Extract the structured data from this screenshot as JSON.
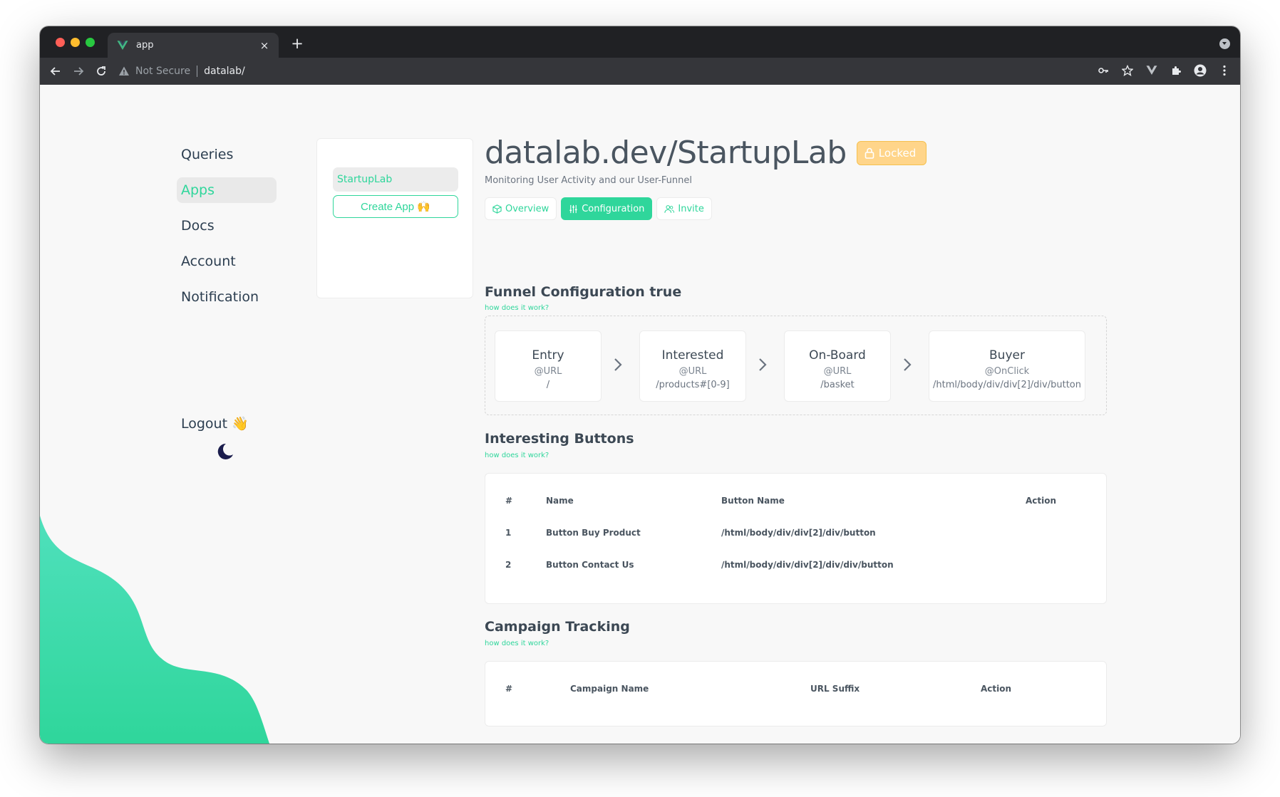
{
  "browser": {
    "tab_title": "app",
    "new_tab_symbol": "+",
    "close_symbol": "×",
    "not_secure": "Not Secure",
    "url": "datalab/"
  },
  "sidebar": {
    "items": [
      {
        "label": "Queries"
      },
      {
        "label": "Apps"
      },
      {
        "label": "Docs"
      },
      {
        "label": "Account"
      },
      {
        "label": "Notification"
      }
    ],
    "logout": "Logout 👋"
  },
  "apps": {
    "items": [
      "StartupLab"
    ],
    "create_label": "Create App 🙌"
  },
  "header": {
    "title": "datalab.dev/StartupLab",
    "locked_label": "Locked",
    "subtitle": "Monitoring User Activity and our User-Funnel"
  },
  "tabs": [
    {
      "label": "Overview",
      "icon": "cube-icon"
    },
    {
      "label": "Configuration",
      "icon": "sliders-icon"
    },
    {
      "label": "Invite",
      "icon": "users-icon"
    }
  ],
  "funnel": {
    "title": "Funnel Configuration true",
    "help": "how does it work?",
    "steps": [
      {
        "name": "Entry",
        "type": "@URL",
        "value": "/"
      },
      {
        "name": "Interested",
        "type": "@URL",
        "value": "/products#[0-9]"
      },
      {
        "name": "On-Board",
        "type": "@URL",
        "value": "/basket"
      },
      {
        "name": "Buyer",
        "type": "@OnClick",
        "value": "/html/body/div/div[2]/div/button"
      }
    ]
  },
  "buttons": {
    "title": "Interesting Buttons",
    "help": "how does it work?",
    "headers": [
      "#",
      "Name",
      "Button Name",
      "Action"
    ],
    "rows": [
      [
        "1",
        "Button Buy Product",
        "/html/body/div/div[2]/div/button"
      ],
      [
        "2",
        "Button Contact Us",
        "/html/body/div/div[2]/div/div/button"
      ]
    ]
  },
  "campaigns": {
    "title": "Campaign Tracking",
    "help": "how does it work?",
    "headers": [
      "#",
      "Campaign Name",
      "URL Suffix",
      "Action"
    ]
  },
  "colors": {
    "accent": "#2fd69b",
    "locked": "#ffd58a",
    "blob_top": "#4fe0bc",
    "blob_bottom": "#2fd69b"
  }
}
